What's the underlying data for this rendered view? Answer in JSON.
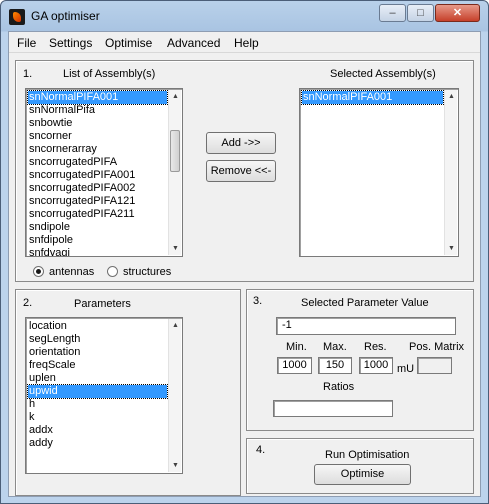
{
  "window": {
    "title": "GA optimiser",
    "minimize_glyph": "–",
    "maximize_glyph": "□",
    "close_glyph": "✕"
  },
  "menubar": {
    "items": [
      "File",
      "Settings",
      "Optimise",
      "Advanced",
      "Help"
    ]
  },
  "panel1": {
    "number": "1.",
    "list_title": "List of Assembly(s)",
    "assemblies": [
      "snNormalPIFA001",
      "snNormalPifa",
      "snbowtie",
      "sncorner",
      "sncornerarray",
      "sncorrugatedPIFA",
      "sncorrugatedPIFA001",
      "sncorrugatedPIFA002",
      "sncorrugatedPIFA121",
      "sncorrugatedPIFA211",
      "sndipole",
      "snfdipole",
      "snfdyagi"
    ],
    "selected_assembly_index": 0,
    "selected_title": "Selected Assembly(s)",
    "selected_assemblies": [
      "snNormalPIFA001"
    ],
    "add_label": "Add ->>",
    "remove_label": "Remove <<-",
    "radio_antennas": "antennas",
    "radio_structures": "structures",
    "radio_selected": "antennas"
  },
  "panel2": {
    "number": "2.",
    "title": "Parameters",
    "parameters": [
      "location",
      "segLength",
      "orientation",
      "freqScale",
      "uplen",
      "upwid",
      "h",
      "k",
      "addx",
      "addy"
    ],
    "selected_parameter_index": 5
  },
  "panel3": {
    "number": "3.",
    "title": "Selected Parameter Value",
    "value": "-1",
    "min_label": "Min.",
    "max_label": "Max.",
    "res_label": "Res.",
    "pos_matrix_label": "Pos. Matrix",
    "min_value": "1000",
    "max_value": "150",
    "res_value": "1000",
    "unit": "mU",
    "pos_matrix_value": "",
    "ratios_label": "Ratios",
    "ratios_value": ""
  },
  "panel4": {
    "number": "4.",
    "title": "Run Optimisation",
    "button_label": "Optimise"
  },
  "colors": {
    "selection": "#3399ff",
    "title_gradient_top": "#b9d1ea",
    "close_button": "#c6402a"
  }
}
